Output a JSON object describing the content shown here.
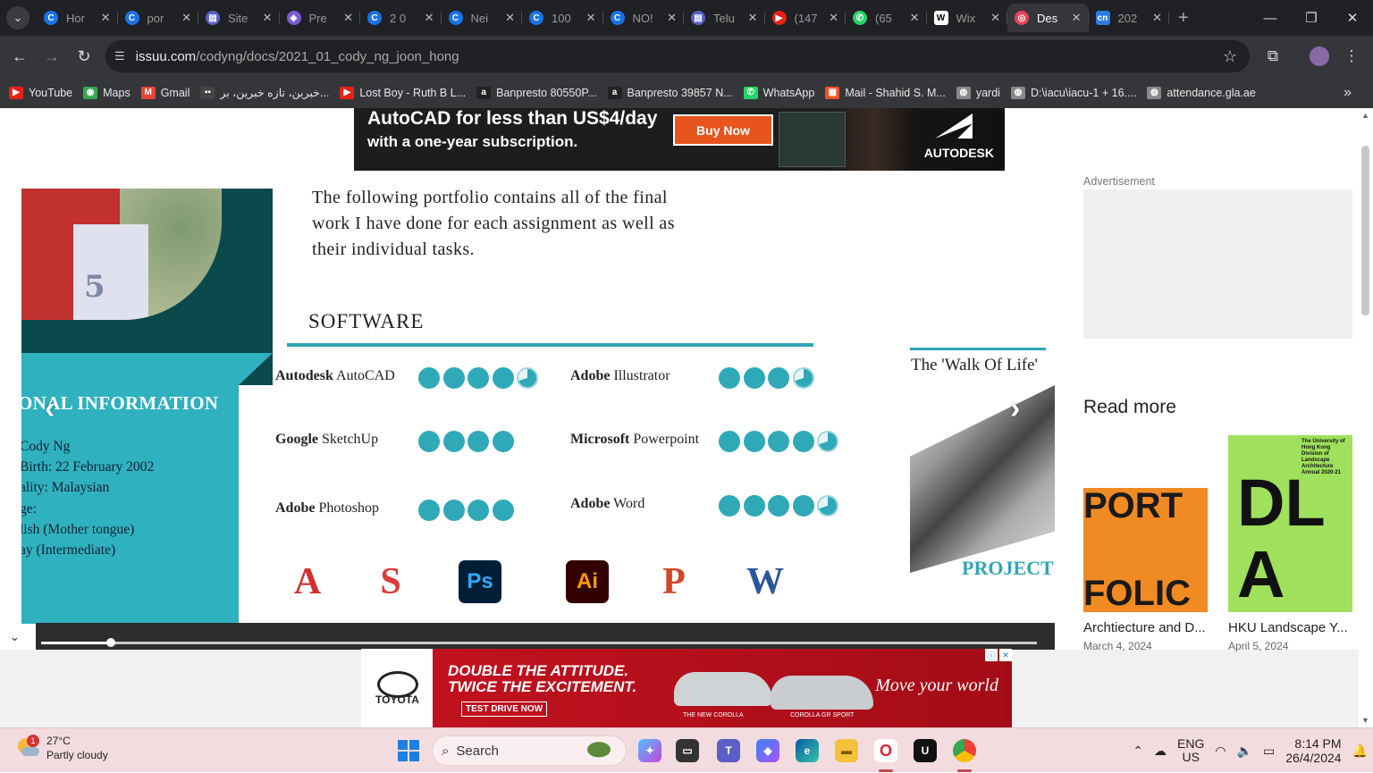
{
  "browser": {
    "tabs": [
      {
        "title": "Hor",
        "fav": "C",
        "color": "#1a73e8"
      },
      {
        "title": "por",
        "fav": "C",
        "color": "#1a73e8"
      },
      {
        "title": "Site",
        "fav": "▤",
        "color": "#5b5fc7"
      },
      {
        "title": "Pre",
        "fav": "◈",
        "color": "#7b5cd6"
      },
      {
        "title": "2 0",
        "fav": "C",
        "color": "#1a73e8"
      },
      {
        "title": "Nei",
        "fav": "C",
        "color": "#1a73e8"
      },
      {
        "title": "100",
        "fav": "C",
        "color": "#1a73e8"
      },
      {
        "title": "NO!",
        "fav": "C",
        "color": "#1a73e8"
      },
      {
        "title": "Telu",
        "fav": "▤",
        "color": "#5b5fc7"
      },
      {
        "title": "(147",
        "fav": "▶",
        "color": "#e62117"
      },
      {
        "title": "(65",
        "fav": "✆",
        "color": "#25d366"
      },
      {
        "title": "Wix",
        "fav": "W",
        "color": "#ffffff"
      },
      {
        "title": "Des -",
        "fav": "◎",
        "color": "#e8415b"
      },
      {
        "title": "202",
        "fav": "cn",
        "color": "#2c7be5"
      }
    ],
    "active_tab_index": 12,
    "url_host": "issuu.com",
    "url_path": "/codyng/docs/2021_01_cody_ng_joon_hong",
    "bookmarks": [
      {
        "label": "YouTube",
        "icon": "▶",
        "color": "#e62117"
      },
      {
        "label": "Maps",
        "icon": "◉",
        "color": "#34a853"
      },
      {
        "label": "Gmail",
        "icon": "M",
        "color": "#ea4335"
      },
      {
        "label": "خبرين، تازه خبرين، بر...",
        "icon": "▪▪",
        "color": "#444444"
      },
      {
        "label": "Lost Boy - Ruth B L...",
        "icon": "▶",
        "color": "#e62117"
      },
      {
        "label": "Banpresto 80550P...",
        "icon": "a",
        "color": "#222222"
      },
      {
        "label": "Banpresto 39857 N...",
        "icon": "a",
        "color": "#222222"
      },
      {
        "label": "WhatsApp",
        "icon": "✆",
        "color": "#25d366"
      },
      {
        "label": "Mail - Shahid S. M...",
        "icon": "▦",
        "color": "#f25022"
      },
      {
        "label": "yardi",
        "icon": "◍",
        "color": "#888888"
      },
      {
        "label": "D:\\iacu\\iacu-1 + 16....",
        "icon": "◍",
        "color": "#888888"
      },
      {
        "label": "attendance.gla.ae",
        "icon": "◍",
        "color": "#888888"
      }
    ]
  },
  "top_ad": {
    "line1": "AutoCAD for less than US$4/day",
    "line2": "with a one-year subscription.",
    "button": "Buy Now",
    "brand": "AUTODESK"
  },
  "document": {
    "intro": "The following portfolio contains all of the final work I have done for each assignment as well as their individual tasks.",
    "info_heading": "ONAL INFORMATION",
    "info_lines": [
      "Cody Ng",
      " Birth: 22 February 2002",
      "ality: Malaysian",
      "ge:",
      "lish (Mother tongue)",
      "ay (Intermediate)"
    ],
    "software_title": "SOFTWARE",
    "skills": [
      {
        "brand": "Autodesk",
        "name": "AutoCAD",
        "rating": 4.7
      },
      {
        "brand": "Google",
        "name": "SketchUp",
        "rating": 4
      },
      {
        "brand": "Adobe",
        "name": "Photoshop",
        "rating": 4
      },
      {
        "brand": "Adobe",
        "name": "Illustrator",
        "rating": 3.7
      },
      {
        "brand": "Microsoft",
        "name": "Powerpoint",
        "rating": 4.7
      },
      {
        "brand": "Adobe",
        "name": "Word",
        "rating": 4.7
      }
    ],
    "app_icons": [
      {
        "name": "autocad-icon",
        "glyph": "A",
        "bg": "#ffffff",
        "fg": "#d42f2f"
      },
      {
        "name": "sketchup-icon",
        "glyph": "S",
        "bg": "#ffffff",
        "fg": "#e03a3a"
      },
      {
        "name": "photoshop-icon",
        "glyph": "Ps",
        "bg": "#001e36",
        "fg": "#31a8ff"
      },
      {
        "name": "illustrator-icon",
        "glyph": "Ai",
        "bg": "#330000",
        "fg": "#ff9a00"
      },
      {
        "name": "powerpoint-icon",
        "glyph": "P",
        "bg": "#ffffff",
        "fg": "#d24726"
      },
      {
        "name": "word-icon",
        "glyph": "W",
        "bg": "#ffffff",
        "fg": "#2b579a"
      }
    ],
    "project_title": "The 'Walk Of Life'",
    "project_label": "PROJECT",
    "progress_fraction": 0.07
  },
  "sidebar": {
    "ad_label": "Advertisement",
    "read_more": "Read more",
    "cards": [
      {
        "title": "Archtiecture and D...",
        "date": "March 4, 2024",
        "cover_text_top": "PORT",
        "cover_text_bottom": "FOLIC"
      },
      {
        "title": "HKU Landscape Y...",
        "date": "April 5, 2024",
        "cover_text": "The University of Hong Kong Division of Landscape Architecture Annual 2020-21",
        "cover_big": "DLA"
      }
    ]
  },
  "bottom_ad": {
    "brand": "TOYOTA",
    "line1": "DOUBLE THE ATTITUDE.",
    "line2": "TWICE THE EXCITEMENT.",
    "cta": "TEST DRIVE NOW",
    "car1": "THE NEW COROLLA",
    "car2": "COROLLA GR SPORT",
    "tagline": "Move your world"
  },
  "taskbar": {
    "temp": "27°C",
    "condition": "Partly cloudy",
    "badge": "1",
    "search": "Search",
    "lang1": "ENG",
    "lang2": "US",
    "time": "8:14 PM",
    "date": "26/4/2024"
  }
}
